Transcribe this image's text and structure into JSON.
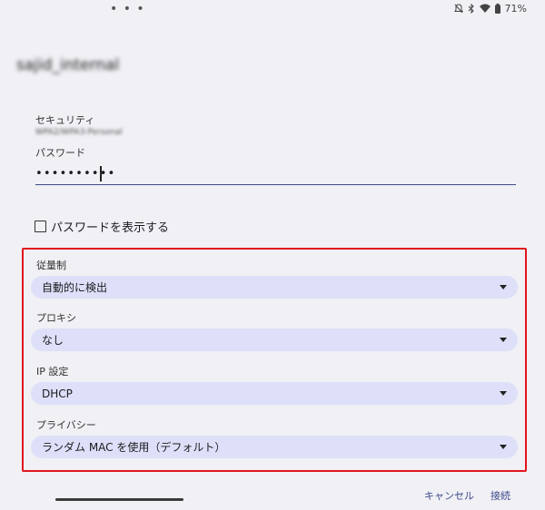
{
  "status_bar": {
    "menu_dots": "• • •",
    "battery_text": "71%"
  },
  "dialog": {
    "title": "sajid_internal",
    "security_label": "セキュリティ",
    "security_value": "WPA2/WPA3-Personal",
    "password_label": "パスワード",
    "password_value": "••••••••••",
    "show_password_label": "パスワードを表示する",
    "metered": {
      "label": "従量制",
      "value": "自動的に検出"
    },
    "proxy": {
      "label": "プロキシ",
      "value": "なし"
    },
    "ip_settings": {
      "label": "IP 設定",
      "value": "DHCP"
    },
    "privacy": {
      "label": "プライバシー",
      "value": "ランダム MAC を使用（デフォルト）"
    },
    "cancel_label": "キャンセル",
    "connect_label": "接続"
  },
  "colors": {
    "background": "#f0f0f5",
    "dropdown_fill": "#dde0f8",
    "accent": "#3d4a8c",
    "highlight_border": "#e1151d"
  }
}
